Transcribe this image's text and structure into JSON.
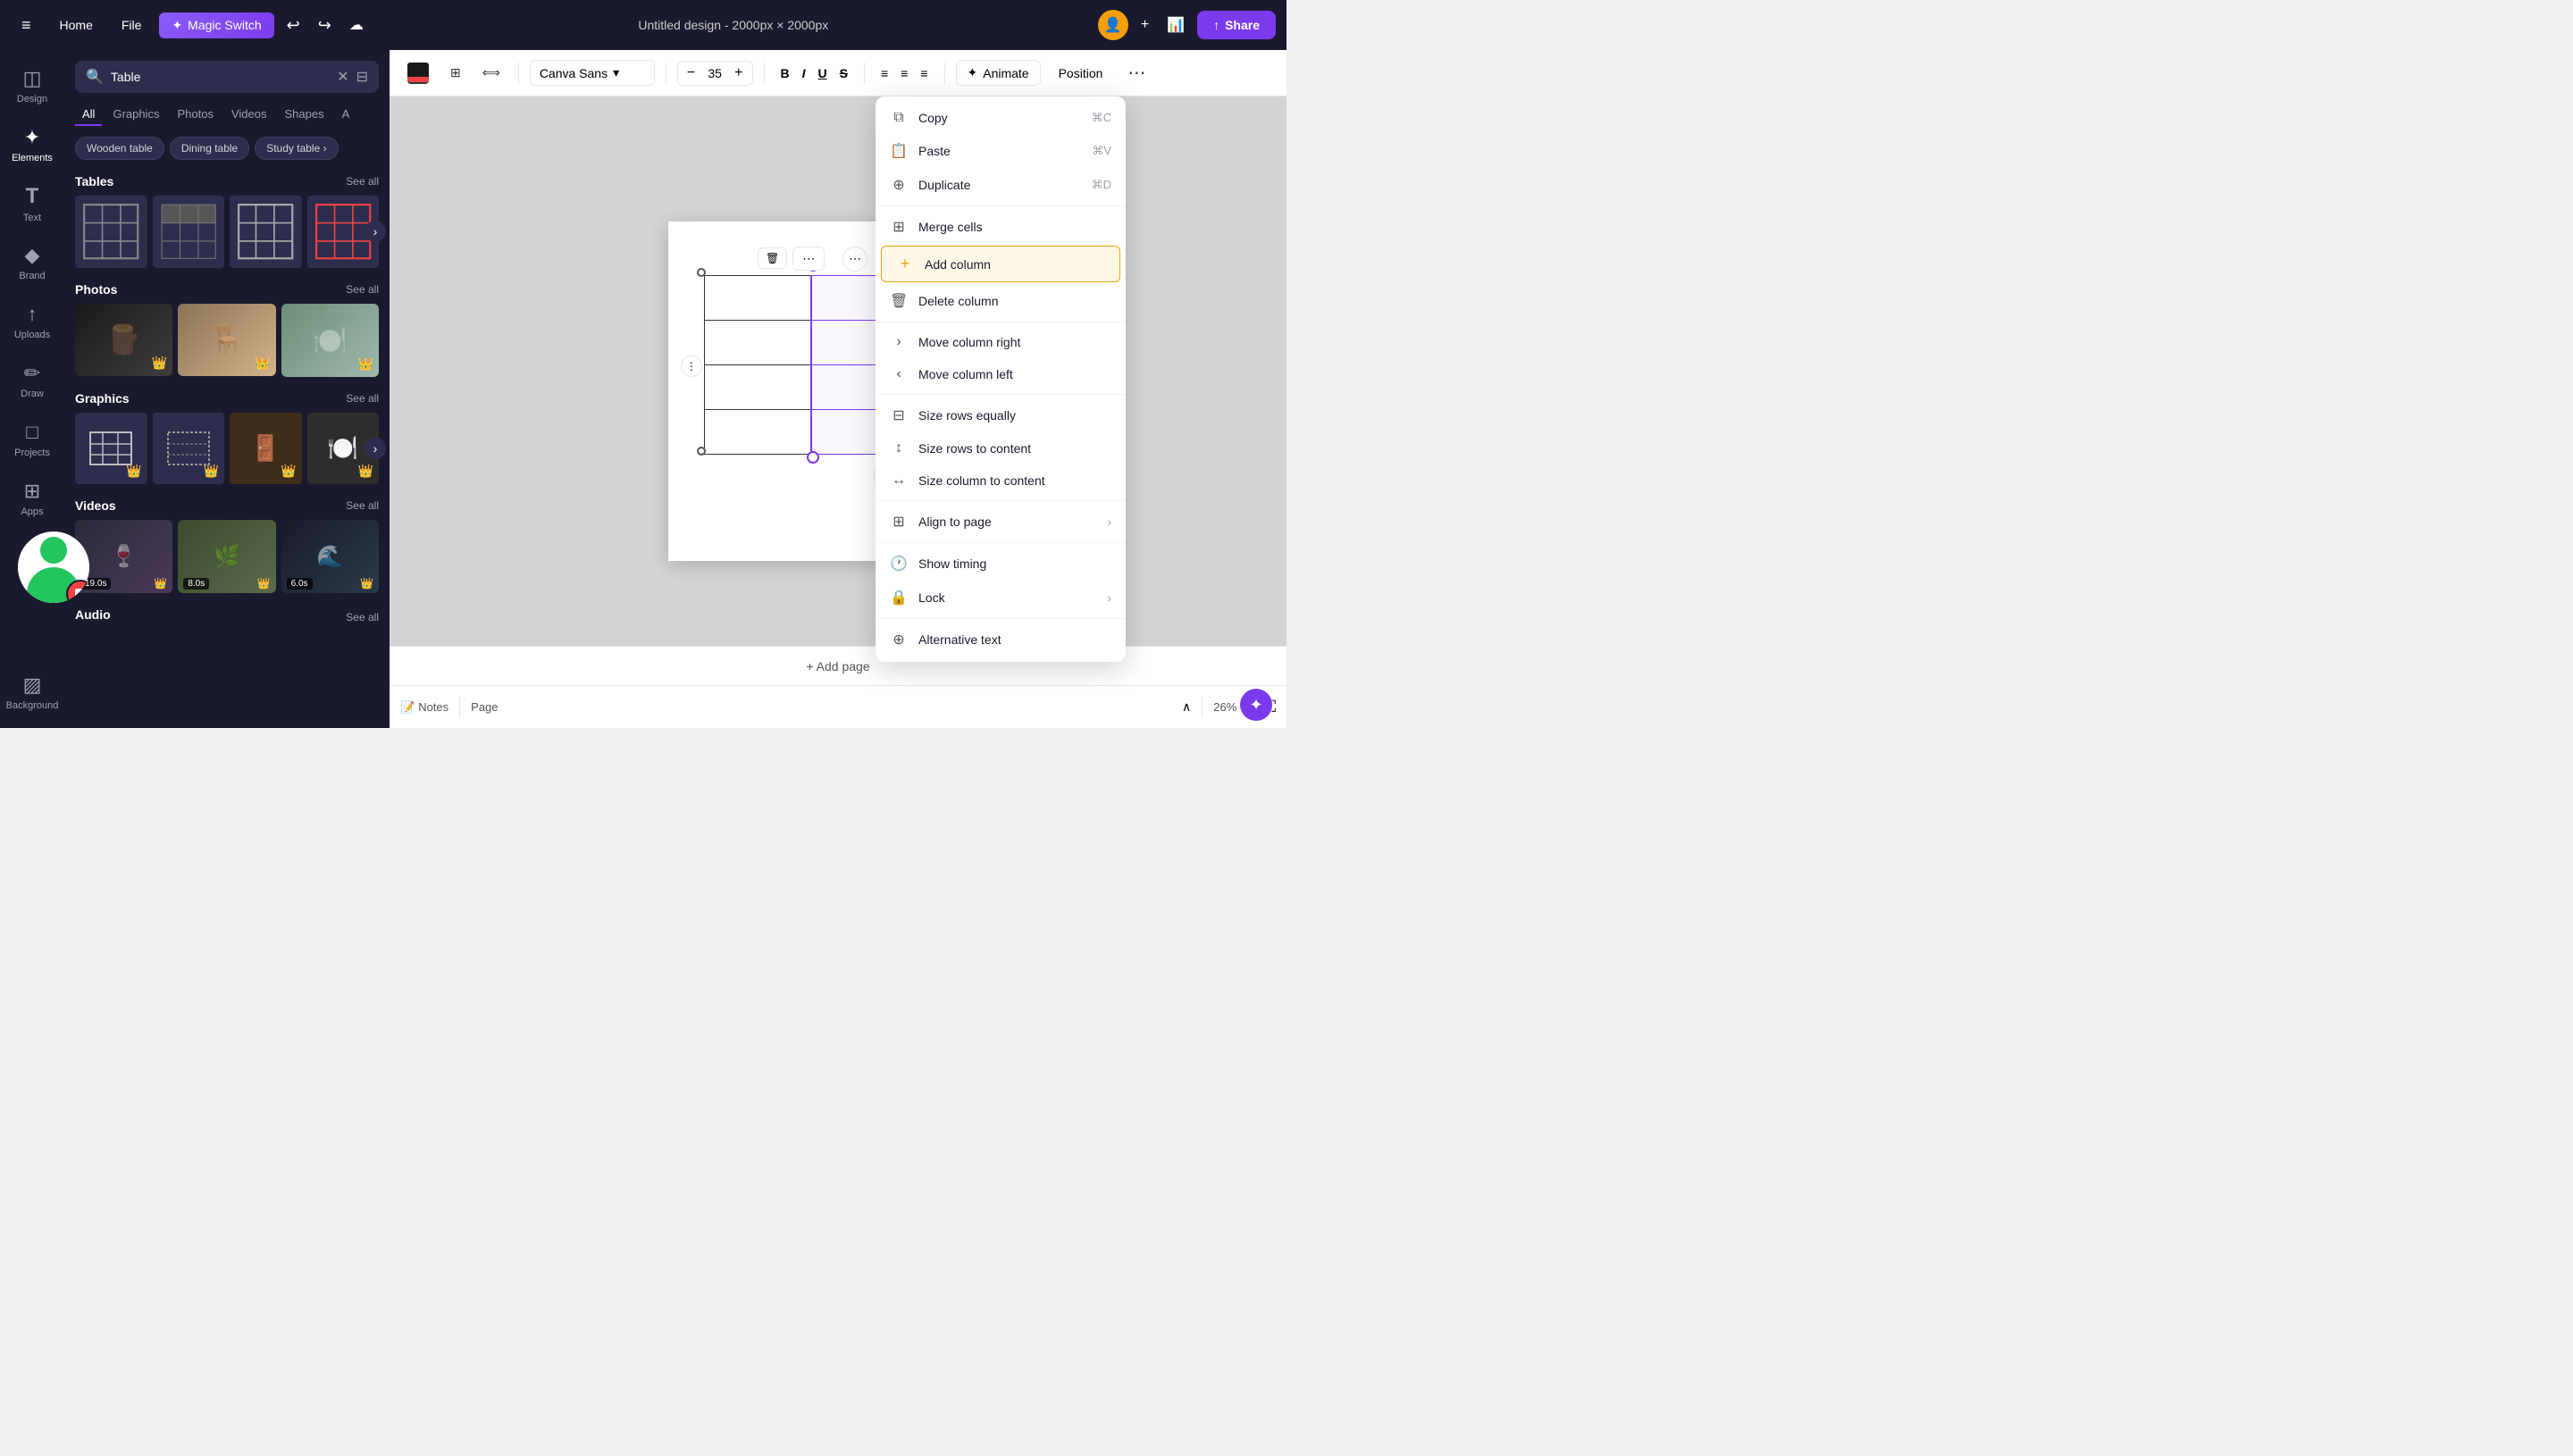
{
  "topbar": {
    "home_label": "Home",
    "file_label": "File",
    "magic_switch_label": "Magic Switch",
    "title": "Untitled design - 2000px × 2000px",
    "share_label": "Share",
    "plus_icon": "+",
    "bars_icon": "≡",
    "undo_icon": "↩",
    "redo_icon": "↪",
    "cloud_icon": "☁"
  },
  "toolbar": {
    "grid_icon": "⊞",
    "stretch_icon": "⟺",
    "font_name": "Canva Sans",
    "font_size": "35",
    "minus_icon": "−",
    "plus_icon": "+",
    "bold_label": "B",
    "italic_label": "I",
    "underline_label": "U",
    "strikethrough_label": "S",
    "align_left": "≡",
    "align_center": "≡",
    "align_right": "≡",
    "animate_label": "Animate",
    "position_label": "Position",
    "more_icon": "⋯"
  },
  "sidebar": {
    "items": [
      {
        "id": "design",
        "label": "Design",
        "icon": "◫"
      },
      {
        "id": "elements",
        "label": "Elements",
        "icon": "✦",
        "active": true
      },
      {
        "id": "text",
        "label": "Text",
        "icon": "T"
      },
      {
        "id": "brand",
        "label": "Brand",
        "icon": "◆"
      },
      {
        "id": "uploads",
        "label": "Uploads",
        "icon": "↑"
      },
      {
        "id": "draw",
        "label": "Draw",
        "icon": "✏"
      },
      {
        "id": "projects",
        "label": "Projects",
        "icon": "□"
      },
      {
        "id": "apps",
        "label": "Apps",
        "icon": "⊞"
      },
      {
        "id": "background",
        "label": "Background",
        "icon": "▨"
      }
    ]
  },
  "search_panel": {
    "search_placeholder": "Table",
    "filter_tabs": [
      "All",
      "Graphics",
      "Photos",
      "Videos",
      "Shapes",
      "A"
    ],
    "active_tab": "All",
    "chips": [
      "Wooden table",
      "Dining table",
      "Study table"
    ],
    "sections": {
      "tables": {
        "title": "Tables",
        "see_all": "See all"
      },
      "photos": {
        "title": "Photos",
        "see_all": "See all"
      },
      "graphics": {
        "title": "Graphics",
        "see_all": "See all"
      },
      "videos": {
        "title": "Videos",
        "see_all": "See all"
      },
      "audio": {
        "title": "Audio",
        "see_all": "See all"
      }
    }
  },
  "context_menu": {
    "items": [
      {
        "id": "copy",
        "label": "Copy",
        "shortcut": "⌘C",
        "icon": "⧉"
      },
      {
        "id": "paste",
        "label": "Paste",
        "shortcut": "⌘V",
        "icon": "📋"
      },
      {
        "id": "duplicate",
        "label": "Duplicate",
        "shortcut": "⌘D",
        "icon": "⊕"
      },
      {
        "id": "merge-cells",
        "label": "Merge cells",
        "shortcut": "",
        "icon": "⊞"
      },
      {
        "id": "add-column",
        "label": "Add column",
        "shortcut": "",
        "icon": "+"
      },
      {
        "id": "delete-column",
        "label": "Delete column",
        "shortcut": "",
        "icon": "🗑"
      },
      {
        "id": "move-column-right",
        "label": "Move column right",
        "shortcut": "",
        "icon": "›",
        "chevron": false
      },
      {
        "id": "move-column-left",
        "label": "Move column left",
        "shortcut": "",
        "icon": "‹",
        "chevron": false
      },
      {
        "id": "size-rows-equally",
        "label": "Size rows equally",
        "shortcut": "",
        "icon": "⊟"
      },
      {
        "id": "size-rows-to-content",
        "label": "Size rows to content",
        "shortcut": "",
        "icon": "↕"
      },
      {
        "id": "size-column-to-content",
        "label": "Size column to content",
        "shortcut": "",
        "icon": "↔"
      },
      {
        "id": "align-to-page",
        "label": "Align to page",
        "shortcut": "",
        "icon": "⊞",
        "chevron": true
      },
      {
        "id": "show-timing",
        "label": "Show timing",
        "shortcut": "",
        "icon": "🕐"
      },
      {
        "id": "lock",
        "label": "Lock",
        "shortcut": "",
        "icon": "🔒",
        "chevron": true
      },
      {
        "id": "alternative-text",
        "label": "Alternative text",
        "shortcut": "",
        "icon": "⊕"
      }
    ]
  },
  "canvas": {
    "delete_icon": "🗑",
    "more_icon": "⋯",
    "dots_icon": "⋮",
    "rotate_icon": "↺",
    "plus_icon": "+"
  },
  "bottom_bar": {
    "notes_label": "Notes",
    "page_label": "Page",
    "zoom_label": "26%",
    "hide_icon": "∧"
  },
  "add_page": {
    "label": "+ Add page"
  }
}
